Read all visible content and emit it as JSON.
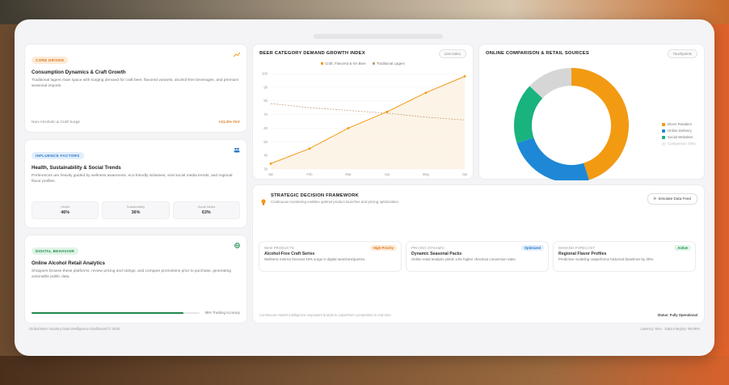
{
  "core_driver": {
    "tag": "CORE DRIVER",
    "title": "Consumption Dynamics & Craft Growth",
    "text": "Traditional lagers main space with surging demand for craft beer, flavored variants, alcohol-free beverages, and premium seasonal imports.",
    "footer_label": "Non-Alcoholic & Craft Surge",
    "footer_value": "+41.3% YoY",
    "icon": "trend-up-icon"
  },
  "influence": {
    "tag": "INFLUENCE FACTORS",
    "title": "Health, Sustainability & Social Trends",
    "text": "Preferences are heavily guided by wellness awareness, eco-friendly initiatives, viral social media trends, and regional flavor profiles.",
    "icon": "people-icon",
    "metrics": [
      {
        "label": "Health",
        "value": "46%"
      },
      {
        "label": "Sustainability",
        "value": "36%"
      },
      {
        "label": "Social Media",
        "value": "63%"
      }
    ]
  },
  "digital": {
    "tag": "DIGITAL BEHAVIOR",
    "title": "Online Alcohol Retail Analytics",
    "text": "Shoppers browse these platforms, review pricing and ratings, and compare promotions prior to purchase, generating actionable public data.",
    "icon": "globe-icon",
    "progress": 0.9,
    "progress_label": "95% Tracking Accuracy",
    "accent": "#1f8a4c"
  },
  "growth_chart": {
    "title": "BEER CATEGORY DEMAND GROWTH INDEX",
    "pill": "Live Index",
    "legend": [
      "Craft, Flavored & NA Beer",
      "Traditional Lagers"
    ]
  },
  "chart_data": {
    "type": "line",
    "categories": [
      "Jan",
      "Feb",
      "Mar",
      "Apr",
      "May",
      "Jun"
    ],
    "ylim": [
      30,
      100
    ],
    "yticks": [
      30,
      40,
      50,
      60,
      70,
      80,
      90,
      100
    ],
    "series": [
      {
        "name": "Craft, Flavored & NA Beer",
        "color": "#f29a12",
        "values": [
          34,
          45,
          60,
          72,
          86,
          98
        ]
      },
      {
        "name": "Traditional Lagers",
        "color": "#c4a07a",
        "values": [
          78,
          75,
          73,
          71,
          68,
          66
        ]
      }
    ],
    "grid": true,
    "legend_position": "top"
  },
  "donut": {
    "title": "ONLINE COMPARISON & RETAIL SOURCES",
    "pill": "Touchpoints",
    "segments": [
      {
        "label": "Direct Retailers",
        "value": 45,
        "color": "#f29a12"
      },
      {
        "label": "Online Delivery",
        "value": 25,
        "color": "#1e88d6"
      },
      {
        "label": "Social Websites",
        "value": 17,
        "color": "#19b37d"
      },
      {
        "label": "Comparison Sites",
        "value": 13,
        "color": "#d6d6d6"
      }
    ]
  },
  "framework": {
    "title": "STRATEGIC DECISION FRAMEWORK",
    "subtitle": "Continuous monitoring enables optimal product launches and pricing optimization",
    "button": "Simulate Data Feed",
    "cards": [
      {
        "category": "NEW PRODUCTS",
        "badge": "High Priority",
        "badge_color": "#d9771a",
        "badge_bg": "#fdebd8",
        "title": "Alcohol-Free Craft Series",
        "text": "Wellness metrics forecast 40% surge in digital searches/queries."
      },
      {
        "category": "PRICING DYNAMIC",
        "badge": "Optimized",
        "badge_color": "#2b79c9",
        "badge_bg": "#e1eefb",
        "title": "Dynamic Seasonal Packs",
        "text": "Online retail analysis yields 14% higher checkout conversion rates."
      },
      {
        "category": "DEMAND FORECAST",
        "badge": "Active",
        "badge_color": "#1f8a4c",
        "badge_bg": "#dff4e6",
        "title": "Regional Flavor Profiles",
        "text": "Predictive modeling outperforms historical baselines by 30%."
      }
    ],
    "footnote": "Continuous market intelligence empowers brands to outperform competitors in real-time.",
    "status": "Status: Fully Operational"
  },
  "footer": {
    "left": "Global Beer Industry Data Intelligence Dashboard © 2026",
    "right": "Latency: 9ms  ·  Data Integrity: 99.99%"
  }
}
